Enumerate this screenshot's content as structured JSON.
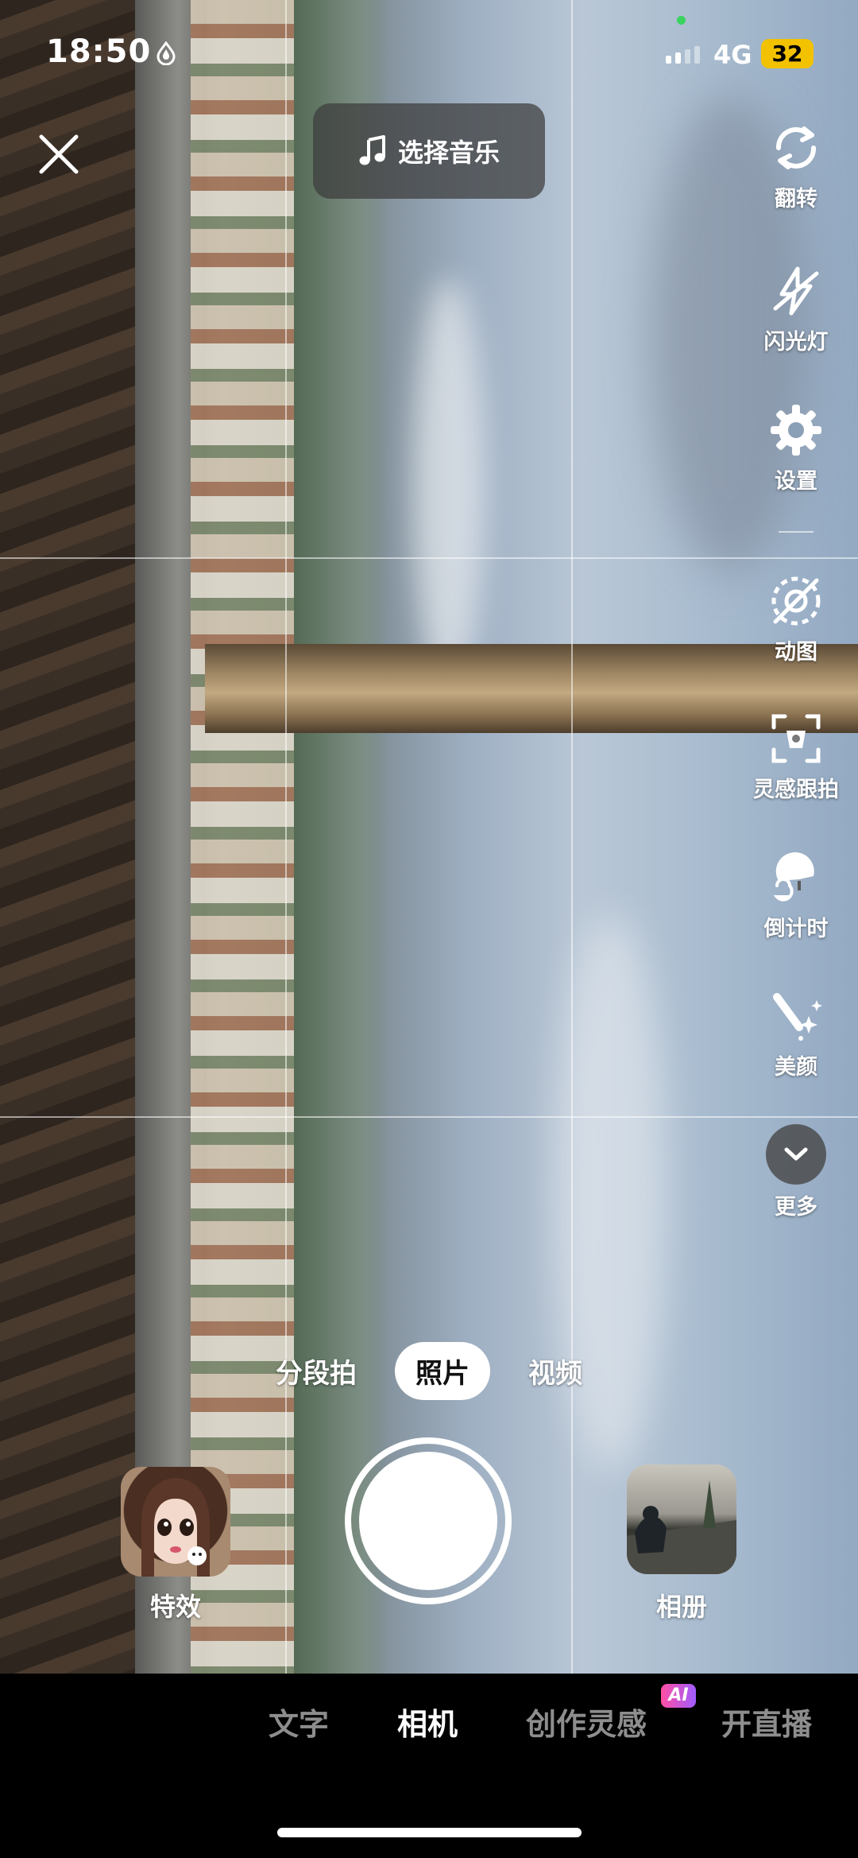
{
  "status_bar": {
    "time": "18:50",
    "network": "4G",
    "battery": "32"
  },
  "top": {
    "music_label": "选择音乐"
  },
  "tools": {
    "flip": "翻转",
    "flash": "闪光灯",
    "settings": "设置",
    "gif": "动图",
    "inspiration_follow": "灵感跟拍",
    "countdown": "倒计时",
    "beauty": "美颜",
    "more": "更多"
  },
  "modes": {
    "items": [
      "分段拍",
      "照片",
      "视频"
    ],
    "selected": "照片"
  },
  "capture": {
    "effects_label": "特效",
    "album_label": "相册"
  },
  "bottom_nav": {
    "items": [
      "文字",
      "相机",
      "创作灵感",
      "开直播"
    ],
    "selected": "相机",
    "ai_badge": "AI"
  }
}
